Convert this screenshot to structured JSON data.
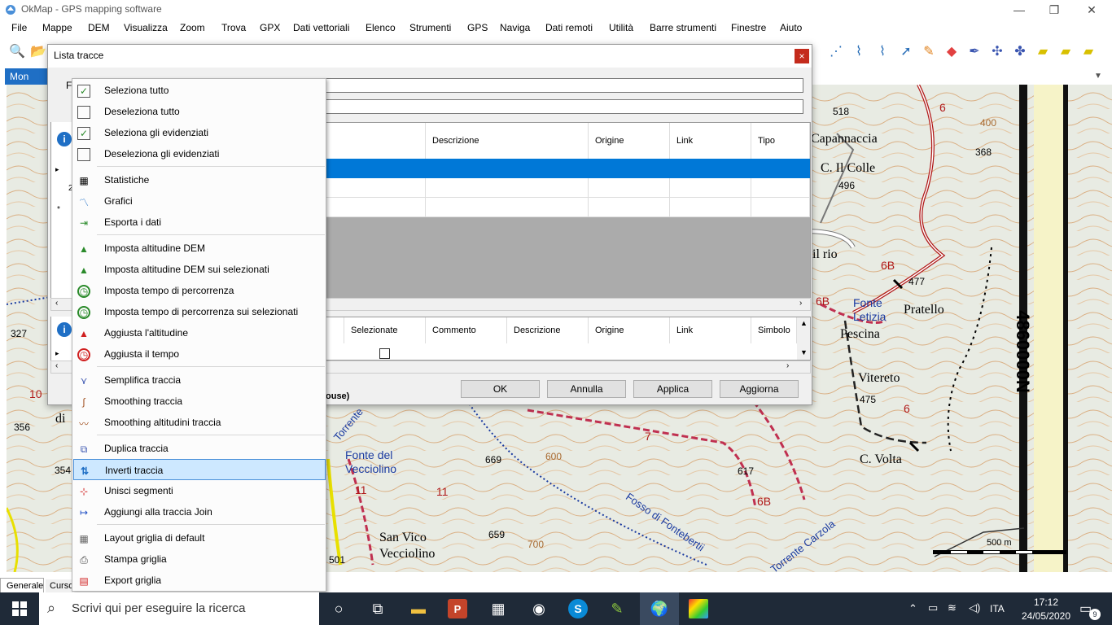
{
  "window": {
    "title": "OkMap - GPS mapping software",
    "minimize": "—",
    "restore": "❐",
    "close": "✕"
  },
  "menu": [
    "File",
    "Mappe",
    "DEM",
    "Visualizza",
    "Zoom",
    "Trova",
    "GPX",
    "Dati vettoriali",
    "Elenco",
    "Strumenti",
    "GPS",
    "Naviga",
    "Dati remoti",
    "Utilità",
    "Barre strumenti",
    "Finestre",
    "Aiuto"
  ],
  "map_tab": "Mon",
  "map": {
    "labels": [
      "Capannaccia",
      "C. Il Colle",
      "Pratello",
      "Pescina",
      "Vitereto",
      "C. Volta",
      "Fonte del",
      "Vecciolino",
      "San Vico",
      "Vecciolino",
      "Fonte",
      "Letizia",
      "di",
      "il rio"
    ],
    "numbers": [
      "518",
      "368",
      "496",
      "477",
      "475",
      "669",
      "617",
      "659",
      "501",
      "356",
      "354",
      "327",
      "600",
      "700",
      "400",
      "6B",
      "6B",
      "6B",
      "7",
      "11",
      "11",
      "10",
      "6",
      "6"
    ],
    "streams": [
      "Torrente",
      "Fosso di Fontebertii",
      "Torrente Carzola"
    ],
    "grid_label": "4860000N",
    "scale": "500 m"
  },
  "bottom_tabs": [
    "Generale",
    "Curso"
  ],
  "dialog": {
    "title": "Lista tracce",
    "close": "×",
    "filter_label": "F",
    "grid1": {
      "headers": [
        "Descrizione",
        "Origine",
        "Link",
        "Tipo"
      ],
      "row_markers": [
        "▸",
        "2",
        "*"
      ]
    },
    "grid2": {
      "headers": [
        "Selezionate",
        "Commento",
        "Descrizione",
        "Origine",
        "Link",
        "Simbolo"
      ],
      "row_marker": "▸"
    },
    "status": "ouse)",
    "buttons": {
      "ok": "OK",
      "cancel": "Annulla",
      "apply": "Applica",
      "update": "Aggiorna"
    }
  },
  "context_menu": [
    {
      "label": "Seleziona tutto",
      "icon": "checkbox-checked-icon"
    },
    {
      "label": "Deseleziona tutto",
      "icon": "checkbox-empty-icon"
    },
    {
      "label": "Seleziona gli evidenziati",
      "icon": "checkbox-checked-icon"
    },
    {
      "label": "Deseleziona gli evidenziati",
      "icon": "checkbox-empty-icon"
    },
    {
      "label": "Statistiche",
      "icon": "calculator-icon"
    },
    {
      "label": "Grafici",
      "icon": "chart-icon"
    },
    {
      "label": "Esporta i dati",
      "icon": "export-icon"
    },
    {
      "label": "Imposta altitudine DEM",
      "icon": "mountain-icon"
    },
    {
      "label": "Imposta altitudine DEM sui selezionati",
      "icon": "mountain-icon"
    },
    {
      "label": "Imposta tempo di percorrenza",
      "icon": "clock-icon"
    },
    {
      "label": "Imposta tempo di percorrenza sui selezionati",
      "icon": "clock-icon"
    },
    {
      "label": "Aggiusta l'altitudine",
      "icon": "mountain-red-icon"
    },
    {
      "label": "Aggiusta il tempo",
      "icon": "clock-red-icon"
    },
    {
      "label": "Semplifica traccia",
      "icon": "simplify-icon"
    },
    {
      "label": "Smoothing traccia",
      "icon": "smooth-icon"
    },
    {
      "label": "Smoothing altitudini traccia",
      "icon": "smooth-altitude-icon"
    },
    {
      "label": "Duplica traccia",
      "icon": "duplicate-icon"
    },
    {
      "label": "Inverti traccia",
      "icon": "reverse-arrows-icon"
    },
    {
      "label": "Unisci segmenti",
      "icon": "join-segments-icon"
    },
    {
      "label": "Aggiungi alla traccia Join",
      "icon": "append-icon"
    },
    {
      "label": "Layout griglia di default",
      "icon": "grid-layout-icon"
    },
    {
      "label": "Stampa griglia",
      "icon": "print-icon"
    },
    {
      "label": "Export griglia",
      "icon": "export-grid-icon"
    }
  ],
  "taskbar": {
    "search": "Scrivi qui per eseguire la ricerca",
    "lang": "ITA",
    "time": "17:12",
    "date": "24/05/2020",
    "notif": "9"
  }
}
